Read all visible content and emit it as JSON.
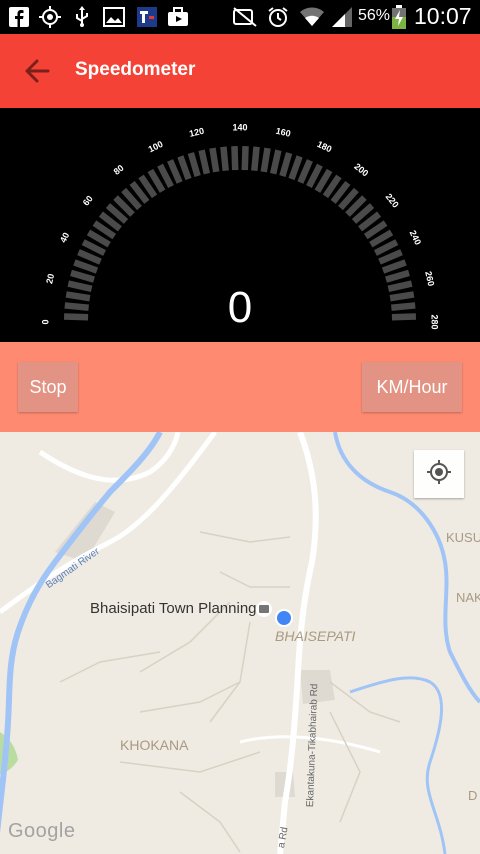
{
  "status_bar": {
    "battery_percent": "56%",
    "time": "10:07",
    "icons": [
      "facebook-icon",
      "gps-icon",
      "usb-icon",
      "image-icon",
      "app-icon",
      "briefcase-icon",
      "mute-icon",
      "alarm-icon",
      "wifi-icon",
      "signal-icon",
      "battery-charging-icon"
    ]
  },
  "app_bar": {
    "title": "Speedometer",
    "color": "#f44336"
  },
  "gauge": {
    "speed": "0",
    "ticks": [
      "0",
      "20",
      "40",
      "60",
      "80",
      "100",
      "120",
      "140",
      "160",
      "180",
      "200",
      "220",
      "240",
      "260",
      "280"
    ]
  },
  "controls": {
    "stop_label": "Stop",
    "unit_label": "KM/Hour"
  },
  "map": {
    "labels": {
      "river": "Bagmati River",
      "place_poi": "Bhaisipati Town Planning",
      "area_bhaisepati": "BHAISEPATI",
      "area_khokana": "KHOKANA",
      "road": "Ekantakuna-Tikabhairab Rd",
      "road_short": "a Rd",
      "edge_kusu": "KUSU",
      "edge_nak": "NAK",
      "edge_d": "D"
    },
    "attribution": "Google"
  }
}
